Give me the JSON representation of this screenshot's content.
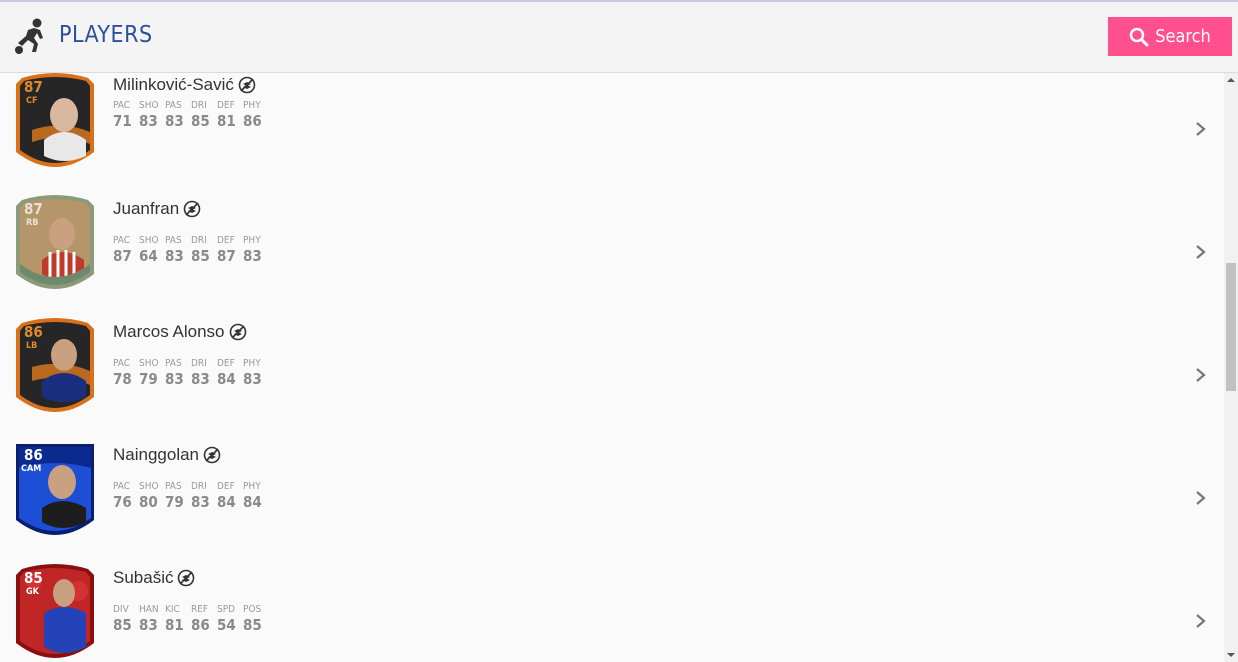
{
  "header": {
    "title": "PLAYERS",
    "search_label": "Search",
    "icon": "player-kicking-icon",
    "search_icon": "search-icon",
    "accent": "#ff4f8c",
    "title_color": "#2c4f9e"
  },
  "players": [
    {
      "name": "Milinković-Savić",
      "rating": "87",
      "position": "CF",
      "card_theme": "ucl-live-orange",
      "card_colors": [
        "#2b2b2b",
        "#e07a1f"
      ],
      "stat_labels": [
        "PAC",
        "SHO",
        "PAS",
        "DRI",
        "DEF",
        "PHY"
      ],
      "stat_values": [
        "71",
        "83",
        "83",
        "85",
        "81",
        "86"
      ]
    },
    {
      "name": "Juanfran",
      "rating": "87",
      "position": "RB",
      "card_theme": "fut-birthday-tan",
      "card_colors": [
        "#b5956a",
        "#6e8a6b"
      ],
      "stat_labels": [
        "PAC",
        "SHO",
        "PAS",
        "DRI",
        "DEF",
        "PHY"
      ],
      "stat_values": [
        "87",
        "64",
        "83",
        "85",
        "87",
        "83"
      ]
    },
    {
      "name": "Marcos Alonso",
      "rating": "86",
      "position": "LB",
      "card_theme": "ucl-live-orange",
      "card_colors": [
        "#2b2b2b",
        "#e07a1f"
      ],
      "stat_labels": [
        "PAC",
        "SHO",
        "PAS",
        "DRI",
        "DEF",
        "PHY"
      ],
      "stat_values": [
        "78",
        "79",
        "83",
        "83",
        "84",
        "83"
      ]
    },
    {
      "name": "Nainggolan",
      "rating": "86",
      "position": "CAM",
      "card_theme": "ucl-blue",
      "card_colors": [
        "#0b2a8f",
        "#1d4fd6"
      ],
      "stat_labels": [
        "PAC",
        "SHO",
        "PAS",
        "DRI",
        "DEF",
        "PHY"
      ],
      "stat_values": [
        "76",
        "80",
        "79",
        "83",
        "84",
        "84"
      ]
    },
    {
      "name": "Subašić",
      "rating": "85",
      "position": "GK",
      "card_theme": "red",
      "card_colors": [
        "#b81c1c",
        "#e03a3a"
      ],
      "stat_labels": [
        "DIV",
        "HAN",
        "KIC",
        "REF",
        "SPD",
        "POS"
      ],
      "stat_values": [
        "85",
        "83",
        "81",
        "86",
        "54",
        "85"
      ]
    }
  ]
}
